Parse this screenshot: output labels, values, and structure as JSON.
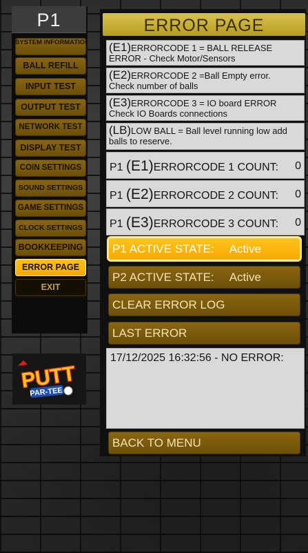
{
  "header": {
    "player": "P1",
    "page_title": "ERROR PAGE"
  },
  "sidebar": {
    "items": [
      {
        "label": "SYSTEM INFORMATION",
        "state": "normal"
      },
      {
        "label": "BALL REFILL",
        "state": "normal"
      },
      {
        "label": "INPUT TEST",
        "state": "normal"
      },
      {
        "label": "OUTPUT TEST",
        "state": "normal"
      },
      {
        "label": "NETWORK TEST",
        "state": "normal"
      },
      {
        "label": "DISPLAY TEST",
        "state": "normal"
      },
      {
        "label": "COIN SETTINGS",
        "state": "normal"
      },
      {
        "label": "SOUND SETTINGS",
        "state": "normal"
      },
      {
        "label": "GAME SETTINGS",
        "state": "normal"
      },
      {
        "label": "CLOCK SETTINGS",
        "state": "normal"
      },
      {
        "label": "BOOKKEEPING",
        "state": "normal"
      },
      {
        "label": "ERROR PAGE",
        "state": "active"
      },
      {
        "label": "EXIT",
        "state": "exit"
      }
    ],
    "logo_text": [
      "PUTT",
      "PAR-TEE"
    ]
  },
  "errors": [
    {
      "code": "(E1)",
      "title": "ERRORCODE 1 = BALL RELEASE",
      "desc": "ERROR - Check Motor/Sensors"
    },
    {
      "code": "(E2)",
      "title": "ERRORCODE 2 =Ball Empty error.",
      "desc": "Check number of balls"
    },
    {
      "code": "(E3)",
      "title": "ERRORCODE 3 = IO board ERROR",
      "desc": "Check IO Boards connections"
    },
    {
      "code": "(LB)",
      "title": "LOW BALL = Ball level running low add",
      "desc": "balls to reserve."
    }
  ],
  "counts": [
    {
      "prefix": "P1",
      "code": "(E1)",
      "label": "ERRORCODE 1 COUNT:",
      "value": "0"
    },
    {
      "prefix": "P1",
      "code": "(E2)",
      "label": "ERRORCODE 2 COUNT:",
      "value": "0"
    },
    {
      "prefix": "P1",
      "code": "(E3)",
      "label": "ERRORCODE 3 COUNT:",
      "value": "0"
    }
  ],
  "states": {
    "p1": {
      "label": "P1 ACTIVE STATE:",
      "value": "Active"
    },
    "p2": {
      "label": "P2 ACTIVE STATE:",
      "value": "Active"
    }
  },
  "actions": {
    "clear_log": "CLEAR ERROR LOG",
    "last_error": "LAST ERROR",
    "back": "BACK TO MENU"
  },
  "log": {
    "last_entry": "17/12/2025 16:32:56 - NO ERROR:"
  },
  "colors": {
    "accent": "#ffc21a",
    "button": "#7a5a0e",
    "title_bar": "#c9b038",
    "panel": "#d9d9d9"
  }
}
